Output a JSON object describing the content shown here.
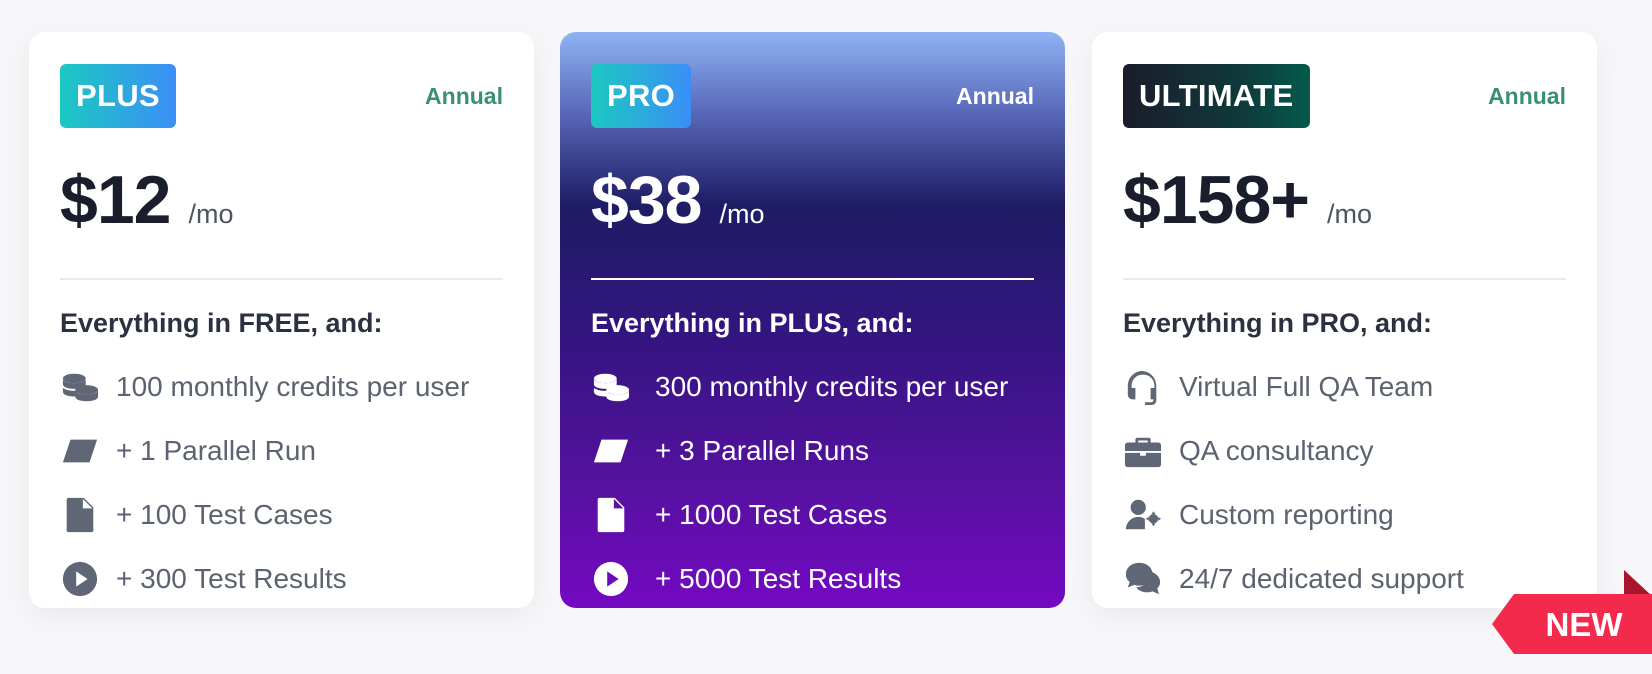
{
  "plans": [
    {
      "badge": "PLUS",
      "billing": "Annual",
      "price": "$12",
      "period": "/mo",
      "intro": "Everything in FREE, and:",
      "features": [
        {
          "icon": "coins-icon",
          "text": "100 monthly credits per user"
        },
        {
          "icon": "parallelogram-icon",
          "text": "+ 1 Parallel Run"
        },
        {
          "icon": "document-icon",
          "text": "+ 100 Test Cases"
        },
        {
          "icon": "play-circle-icon",
          "text": "+ 300 Test Results"
        }
      ]
    },
    {
      "badge": "PRO",
      "billing": "Annual",
      "price": "$38",
      "period": "/mo",
      "intro": "Everything in PLUS, and:",
      "features": [
        {
          "icon": "coins-icon",
          "text": "300 monthly credits per user"
        },
        {
          "icon": "parallelogram-icon",
          "text": "+ 3 Parallel Runs"
        },
        {
          "icon": "document-icon",
          "text": "+ 1000 Test Cases"
        },
        {
          "icon": "play-circle-icon",
          "text": "+ 5000 Test Results"
        }
      ]
    },
    {
      "badge": "ULTIMATE",
      "billing": "Annual",
      "price": "$158+",
      "period": "/mo",
      "intro": "Everything in PRO, and:",
      "features": [
        {
          "icon": "headset-icon",
          "text": "Virtual Full QA Team"
        },
        {
          "icon": "briefcase-icon",
          "text": "QA consultancy"
        },
        {
          "icon": "user-gear-icon",
          "text": "Custom reporting"
        },
        {
          "icon": "chat-bubbles-icon",
          "text": "24/7 dedicated support"
        }
      ]
    }
  ],
  "ribbon": {
    "label": "NEW"
  },
  "colors": {
    "accent_teal": "#1bc9c1",
    "accent_blue": "#3b8ef7",
    "billing_green": "#3b8f72",
    "pro_top": "#8fb3f5",
    "pro_bottom": "#7409c2",
    "ribbon_red": "#f42a4c"
  }
}
